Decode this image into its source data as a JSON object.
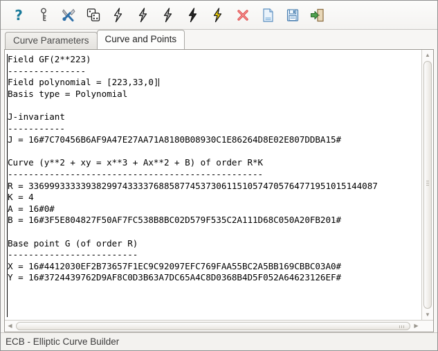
{
  "window": {
    "status_text": "ECB - Elliptic Curve Builder"
  },
  "toolbar": {
    "buttons": [
      {
        "name": "help-icon",
        "label": "Help"
      },
      {
        "name": "key-icon",
        "label": "Key"
      },
      {
        "name": "tools-icon",
        "label": "Tools"
      },
      {
        "name": "dice-icon",
        "label": "Random"
      },
      {
        "name": "lightning-gray-1-icon",
        "label": "Compute 1"
      },
      {
        "name": "lightning-gray-2-icon",
        "label": "Compute 2"
      },
      {
        "name": "lightning-gray-3-icon",
        "label": "Compute 3"
      },
      {
        "name": "lightning-dark-icon",
        "label": "Compute 4"
      },
      {
        "name": "lightning-yellow-icon",
        "label": "Compute 5"
      },
      {
        "name": "delete-icon",
        "label": "Delete"
      },
      {
        "name": "new-document-icon",
        "label": "New"
      },
      {
        "name": "save-icon",
        "label": "Save"
      },
      {
        "name": "exit-icon",
        "label": "Exit"
      }
    ]
  },
  "tabs": [
    {
      "label": "Curve Parameters",
      "active": false
    },
    {
      "label": "Curve and Points",
      "active": true
    }
  ],
  "content": {
    "lines": [
      "Field GF(2**223)",
      "---------------",
      "Field polynomial = [223,33,0]",
      "Basis type = Polynomial",
      "",
      "J-invariant",
      "-----------",
      "J = 16#7C70456B6AF9A47E27AA71A8180B08930C1E86264D8E02E807DDBA15#",
      "",
      "Curve (y**2 + xy = x**3 + Ax**2 + B) of order R*K",
      "-------------------------------------------------",
      "R = 3369993333393829974333376885877453730611510574705764771951015144087",
      "K = 4",
      "A = 16#0#",
      "B = 16#3F5E804827F50AF7FC538B8BC02D579F535C2A111D68C050A20FB201#",
      "",
      "Base point G (of order R)",
      "-------------------------",
      "X = 16#4412030EF2B73657F1EC9C92097EFC769FAA55BC2A5BB169CBBC03A0#",
      "Y = 16#3724439762D9AF8C0D3B63A7DC65A4C8D0368B4D5F052A64623126EF#"
    ],
    "caret_line_index": 2
  },
  "scrollbars": {
    "vertical": {
      "up_glyph": "▲",
      "down_glyph": "▼"
    },
    "horizontal": {
      "left_glyph": "◀",
      "right_glyph": "▶"
    }
  },
  "colors": {
    "background": "#f7f6f4",
    "text_area": "#ffffff",
    "text": "#000000",
    "tab_active": "#fdfdfc",
    "accent_red": "#e04a4a",
    "accent_yellow": "#f5d60a"
  }
}
